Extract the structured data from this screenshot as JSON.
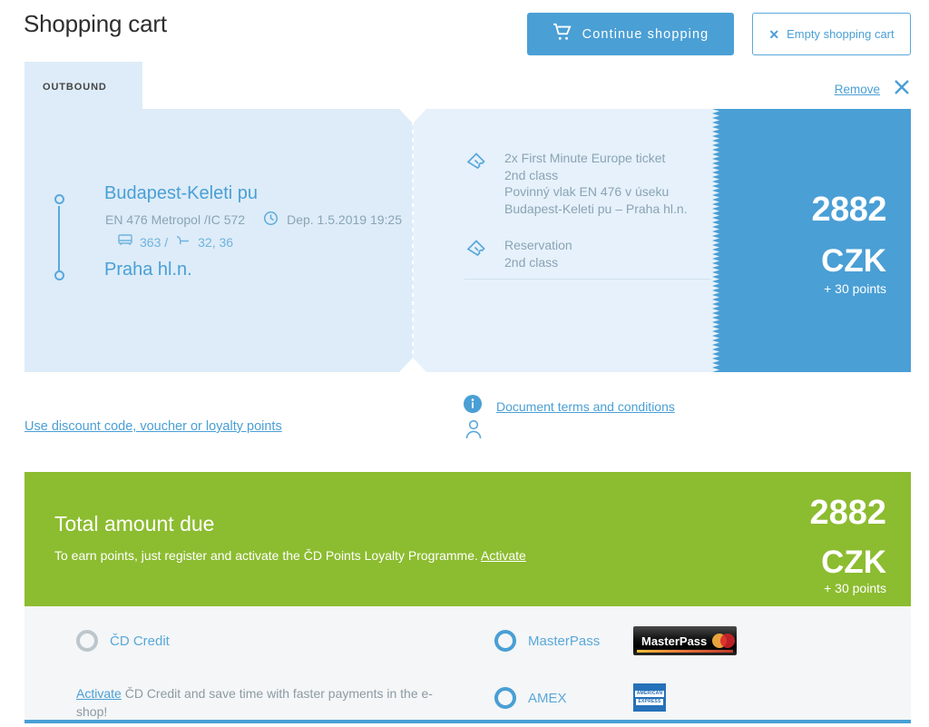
{
  "header": {
    "title": "Shopping cart",
    "continue_label": "Continue shopping",
    "continue_icon": "shopping-cart-icon",
    "empty_label": "Empty shopping cart",
    "empty_icon": "x-icon",
    "accent_blue": "#4a9fd5"
  },
  "ticket": {
    "tab_label": "OUTBOUND",
    "remove_label": "Remove",
    "remove_icon": "close-x-icon",
    "journey": {
      "from": "Budapest-Keleti pu",
      "to": "Praha hl.n.",
      "train": "EN 476 Metropol /IC 572",
      "departure": "Dep. 1.5.2019 19:25",
      "clock_icon": "clock-icon",
      "coach_icon": "coach-icon",
      "coach": "363 /",
      "seat_icon": "seat-icon",
      "seats": "32, 36"
    },
    "items": [
      {
        "icon": "ticket-icon",
        "text": "2x First Minute Europe ticket\n2nd class\nPovinný vlak EN 476 v úseku\nBudapest-Keleti pu – Praha hl.n."
      },
      {
        "icon": "ticket-icon",
        "text": "Reservation\n2nd class"
      }
    ],
    "terms_label": "Document terms and conditions",
    "terms_icon": "info-icon",
    "passenger_icon": "passenger-icon",
    "price": {
      "amount": "2882",
      "currency": "CZK",
      "points": "+ 30 points"
    }
  },
  "discount_link": "Use discount code, voucher or loyalty points",
  "total": {
    "title": "Total amount due",
    "note_prefix": "To earn points, just register and activate the ČD Points Loyalty Programme. ",
    "note_link": "Activate",
    "amount": "2882",
    "currency": "CZK",
    "points": "+ 30 points",
    "bg_green": "#8cbc30"
  },
  "payments": {
    "options": [
      {
        "label": "ČD Credit",
        "selected": false,
        "disabled": true
      },
      {
        "label": "MasterPass",
        "selected": false,
        "disabled": false
      },
      {
        "label": "AMEX",
        "selected": false,
        "disabled": false
      }
    ],
    "note_link": "Activate",
    "note_text": " ČD Credit and save time with faster payments in the e-shop!",
    "masterpass_logo_text": "MasterPass",
    "amex_logo_line1": "AMERICAN",
    "amex_logo_line2": "EXPRESS"
  }
}
